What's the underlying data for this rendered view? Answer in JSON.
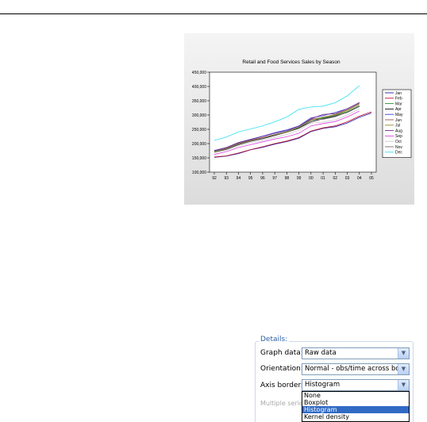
{
  "chart_data": {
    "type": "line",
    "title": "Retail and Food Services Sales by Season",
    "categories": [
      "92",
      "93",
      "94",
      "95",
      "96",
      "97",
      "98",
      "99",
      "00",
      "01",
      "02",
      "03",
      "04",
      "05"
    ],
    "yticks": [
      "450,000",
      "400,000",
      "350,000",
      "300,000",
      "250,000",
      "200,000",
      "150,000",
      "100,000"
    ],
    "ylim": [
      100000,
      450000
    ],
    "grid": false,
    "legend_position": "right",
    "series": [
      {
        "name": "Jan",
        "color": "#1f1faa",
        "values": [
          152000,
          156000,
          165000,
          178000,
          187000,
          198000,
          207000,
          219000,
          242000,
          253000,
          259000,
          272000,
          292000,
          307000
        ]
      },
      {
        "name": "Feb",
        "color": "#c0102a",
        "values": [
          153000,
          157000,
          167000,
          179000,
          189000,
          200000,
          209000,
          221000,
          244000,
          255000,
          262000,
          276000,
          296000,
          311000
        ]
      },
      {
        "name": "Mar",
        "color": "#2c8a2c",
        "values": [
          172000,
          181000,
          198000,
          210000,
          219000,
          230000,
          240000,
          254000,
          281000,
          290000,
          299000,
          312000,
          333000,
          null
        ]
      },
      {
        "name": "Apr",
        "color": "#111111",
        "values": [
          170000,
          180000,
          196000,
          208000,
          217000,
          228000,
          240000,
          254000,
          276000,
          287000,
          296000,
          309000,
          330000,
          null
        ]
      },
      {
        "name": "May",
        "color": "#3b3bd6",
        "values": [
          176000,
          186000,
          204000,
          215000,
          226000,
          238000,
          248000,
          262000,
          290000,
          298000,
          309000,
          322000,
          343000,
          null
        ]
      },
      {
        "name": "Jun",
        "color": "#a05050",
        "values": [
          173000,
          184000,
          201000,
          212000,
          221000,
          232000,
          242000,
          258000,
          285000,
          292000,
          302000,
          318000,
          340000,
          null
        ]
      },
      {
        "name": "Jul",
        "color": "#8b8b2e",
        "values": [
          170000,
          181000,
          198000,
          209000,
          219000,
          230000,
          240000,
          256000,
          281000,
          293000,
          300000,
          316000,
          338000,
          null
        ]
      },
      {
        "name": "Aug",
        "color": "#6a2a8a",
        "values": [
          175000,
          186000,
          203000,
          214000,
          225000,
          236000,
          245000,
          261000,
          287000,
          302000,
          305000,
          322000,
          344000,
          null
        ]
      },
      {
        "name": "Sep",
        "color": "#e040e0",
        "values": [
          162000,
          172000,
          186000,
          196000,
          206000,
          216000,
          224000,
          236000,
          262000,
          270000,
          277000,
          293000,
          314000,
          null
        ]
      },
      {
        "name": "Oct",
        "color": "#c8c8c8",
        "values": [
          168000,
          177000,
          192000,
          203000,
          212000,
          222000,
          232000,
          247000,
          272000,
          275000,
          283000,
          300000,
          322000,
          null
        ]
      },
      {
        "name": "Nov",
        "color": "#707070",
        "values": [
          173000,
          182000,
          199000,
          210000,
          219000,
          231000,
          242000,
          258000,
          283000,
          285000,
          294000,
          310000,
          331000,
          null
        ]
      },
      {
        "name": "Dec",
        "color": "#30e0f0",
        "values": [
          211000,
          223000,
          241000,
          251000,
          262000,
          276000,
          293000,
          320000,
          328000,
          331000,
          343000,
          367000,
          403000,
          null
        ]
      }
    ]
  },
  "details": {
    "legend": "Details:",
    "graph_data_label": "Graph data:",
    "graph_data_value": "Raw data",
    "orientation_label": "Orientation:",
    "orientation_value": "Normal - obs/time across bottom",
    "axis_borders_label": "Axis borders:",
    "axis_borders_value": "Histogram",
    "multiple_series_label": "Multiple series:",
    "axis_borders_options": [
      "None",
      "Boxplot",
      "Histogram",
      "Kernel density"
    ],
    "axis_borders_selected_index": 2
  }
}
